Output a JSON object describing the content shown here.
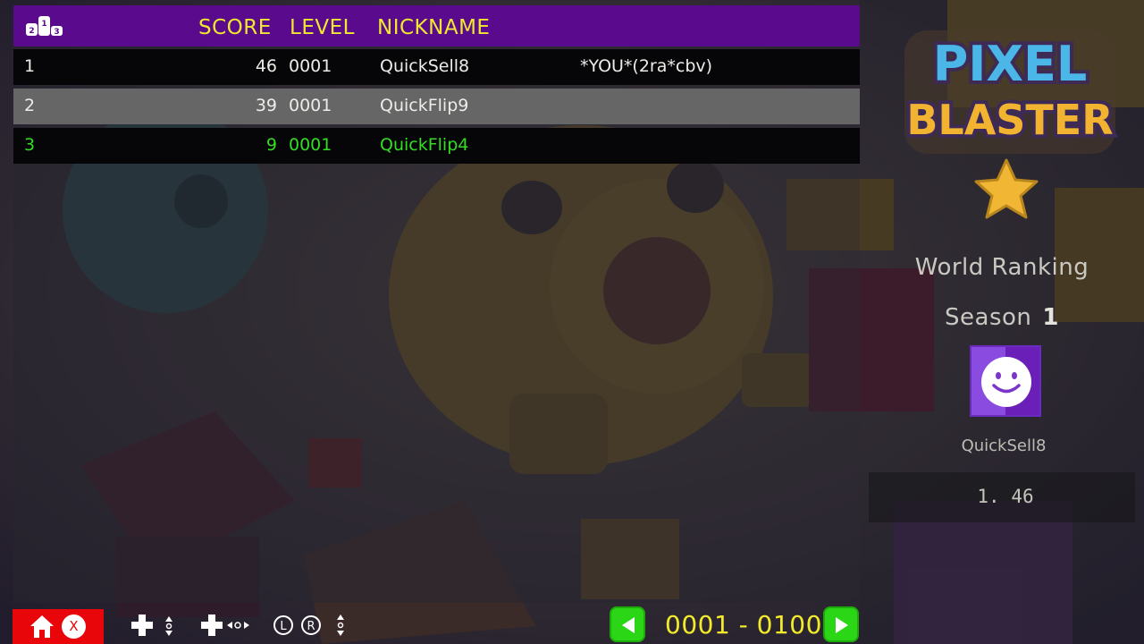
{
  "header": {
    "score_label": "SCORE",
    "level_label": "LEVEL",
    "nickname_label": "NICKNAME",
    "podium_icon": "podium-icon"
  },
  "leaderboard": {
    "rows": [
      {
        "rank": "1",
        "score": "46",
        "level": "0001",
        "nickname": "QuickSell8",
        "tag": "*YOU*(2ra*cbv)"
      },
      {
        "rank": "2",
        "score": "39",
        "level": "0001",
        "nickname": "QuickFlip9",
        "tag": ""
      },
      {
        "rank": "3",
        "score": "9",
        "level": "0001",
        "nickname": "QuickFlip4",
        "tag": ""
      }
    ],
    "highlight_color": "#33dd22"
  },
  "side": {
    "logo_line1": "PIXEL",
    "logo_line2": "BLASTER",
    "world_ranking": "World Ranking",
    "season_label": "Season",
    "season_number": "1",
    "avatar_icon": "smiley-icon",
    "player_name": "QuickSell8",
    "player_rank": "1. 46"
  },
  "footer": {
    "home_icon": "home-icon",
    "close_key": "X",
    "control_hints": [
      "dpad-updown-icon",
      "dpad-leftright-icon",
      "shoulder-lr-icon"
    ],
    "shoulder_left": "L",
    "shoulder_right": "R",
    "page_range": "0001 - 0100",
    "prev_icon": "left-arrow-icon",
    "next_icon": "right-arrow-icon"
  },
  "colors": {
    "header_bg": "#5a0a8c",
    "header_text": "#f0e830",
    "home_button": "#e8060a",
    "nav_green": "#2bd616",
    "page_text": "#f2ea2a"
  }
}
